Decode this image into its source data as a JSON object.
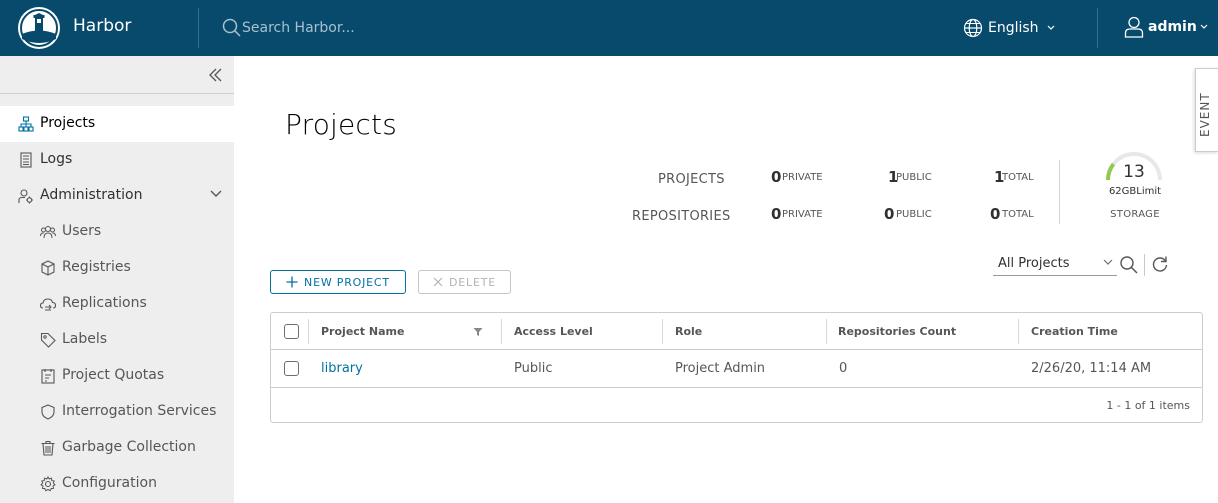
{
  "header": {
    "brand": "Harbor",
    "search_placeholder": "Search Harbor...",
    "language": "English",
    "user": "admin",
    "bg_color": "#084a6c"
  },
  "sidebar": {
    "items": [
      {
        "label": "Projects",
        "icon": "projects-icon",
        "active": true
      },
      {
        "label": "Logs",
        "icon": "logs-icon"
      },
      {
        "label": "Administration",
        "icon": "administration-icon",
        "expanded": true
      },
      {
        "label": "Users",
        "icon": "users-icon"
      },
      {
        "label": "Registries",
        "icon": "registries-icon"
      },
      {
        "label": "Replications",
        "icon": "replications-icon"
      },
      {
        "label": "Labels",
        "icon": "labels-icon"
      },
      {
        "label": "Project Quotas",
        "icon": "project-quotas-icon"
      },
      {
        "label": "Interrogation Services",
        "icon": "interrogation-services-icon"
      },
      {
        "label": "Garbage Collection",
        "icon": "garbage-collection-icon"
      },
      {
        "label": "Configuration",
        "icon": "configuration-icon"
      }
    ]
  },
  "main": {
    "title": "Projects",
    "event_tab": "EVENT",
    "summary": {
      "projects_label": "PROJECTS",
      "repositories_label": "REPOSITORIES",
      "projects": {
        "private": "0",
        "public": "1",
        "total": "1"
      },
      "repositories": {
        "private": "0",
        "public": "0",
        "total": "0"
      },
      "private_label": "PRIVATE",
      "public_label": "PUBLIC",
      "total_label": "TOTAL",
      "storage_value": "13",
      "storage_limit": "62GBLimit",
      "storage_label": "STORAGE",
      "storage_fraction": 0.21
    },
    "actions": {
      "new_project": "NEW PROJECT",
      "delete": "DELETE",
      "filter_selected": "All Projects"
    },
    "table": {
      "columns": [
        "Project Name",
        "Access Level",
        "Role",
        "Repositories Count",
        "Creation Time"
      ],
      "rows": [
        {
          "name": "library",
          "access": "Public",
          "role": "Project Admin",
          "repo_count": "0",
          "created": "2/26/20, 11:14 AM"
        }
      ],
      "footer": "1 - 1 of 1 items"
    },
    "accent_color": "#0072a3"
  }
}
